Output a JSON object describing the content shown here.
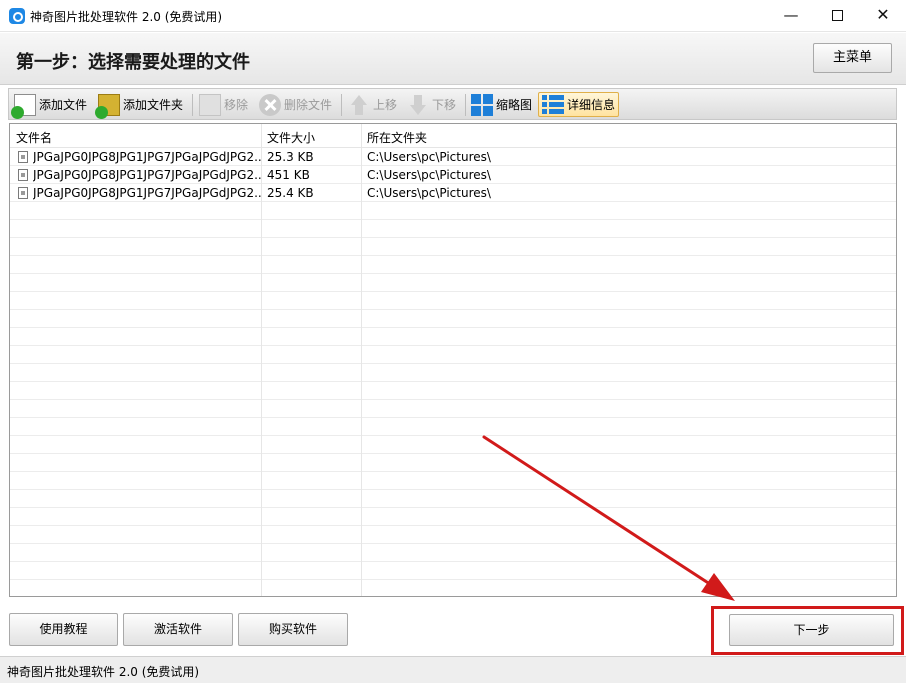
{
  "window": {
    "title": "神奇图片批处理软件 2.0 (免费试用)",
    "minimize_glyph": "—",
    "close_glyph": "✕"
  },
  "header": {
    "step_title": "第一步：选择需要处理的文件",
    "main_menu_label": "主菜单"
  },
  "toolbar": {
    "add_file": "添加文件",
    "add_folder": "添加文件夹",
    "remove": "移除",
    "delete_file": "删除文件",
    "move_up": "上移",
    "move_down": "下移",
    "thumbnail": "缩略图",
    "details": "详细信息"
  },
  "file_list": {
    "columns": [
      "文件名",
      "文件大小",
      "所在文件夹"
    ],
    "rows": [
      {
        "name": "JPGaJPG0JPG8JPG1JPG7JPGaJPGdJPG2...",
        "size": "25.3 KB",
        "folder": "C:\\Users\\pc\\Pictures\\"
      },
      {
        "name": "JPGaJPG0JPG8JPG1JPG7JPGaJPGdJPG2...",
        "size": "451 KB",
        "folder": "C:\\Users\\pc\\Pictures\\"
      },
      {
        "name": "JPGaJPG0JPG8JPG1JPG7JPGaJPGdJPG2...",
        "size": "25.4 KB",
        "folder": "C:\\Users\\pc\\Pictures\\"
      }
    ]
  },
  "footer": {
    "tutorial": "使用教程",
    "activate": "激活软件",
    "buy": "购买软件",
    "next": "下一步"
  },
  "status": {
    "text": "神奇图片批处理软件 2.0 (免费试用)"
  },
  "annotation": {
    "color": "#d11a1a"
  }
}
